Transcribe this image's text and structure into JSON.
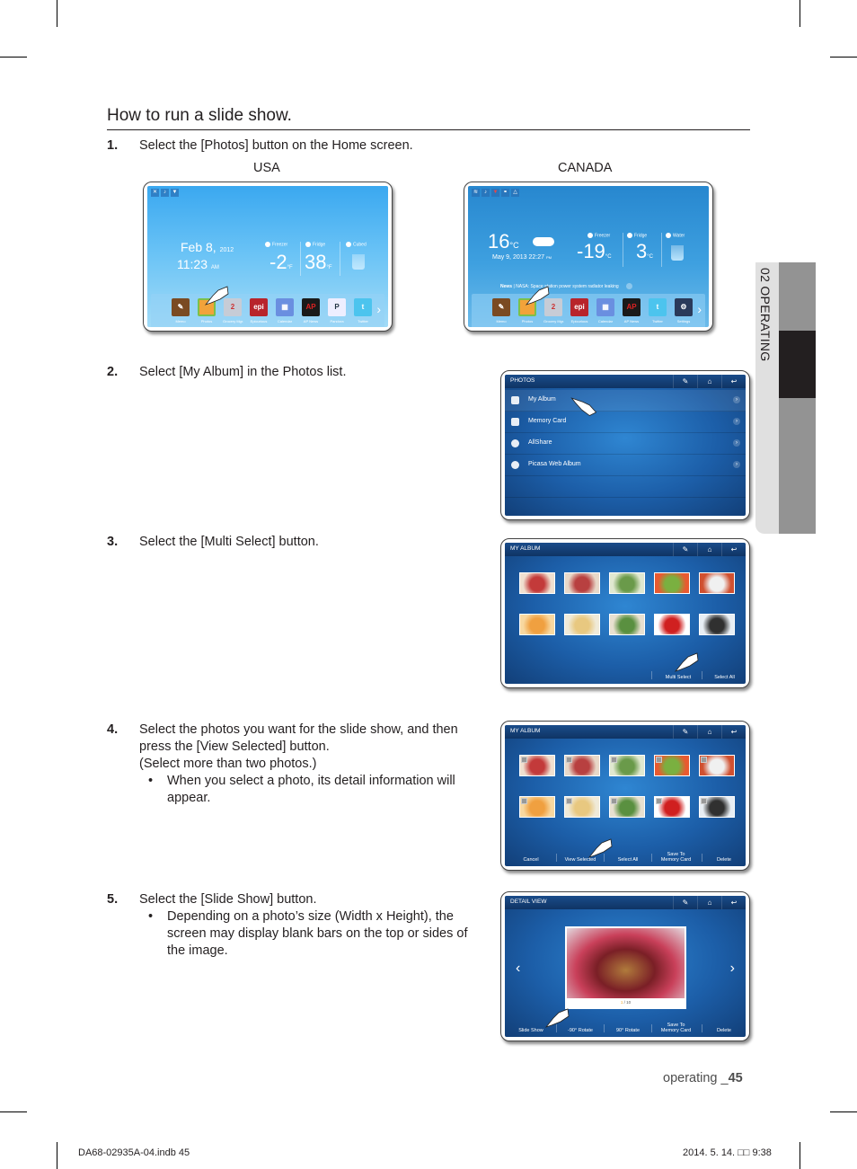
{
  "section": {
    "title": "How to run a slide show."
  },
  "steps": [
    {
      "num": "1.",
      "text": "Select the [Photos] button on the Home screen."
    },
    {
      "num": "2.",
      "text": "Select [My Album] in the Photos list."
    },
    {
      "num": "3.",
      "text": "Select the [Multi Select] button."
    },
    {
      "num": "4.",
      "lines": [
        "Select the photos you want for the slide show, and then",
        "press the [View Selected] button.",
        "(Select more than two photos.)"
      ],
      "bullet": [
        "When you select a photo, its detail information will",
        "appear."
      ]
    },
    {
      "num": "5.",
      "text": "Select the [Slide Show] button.",
      "bullet": [
        "Depending on a photo’s size (Width x Height), the",
        "screen may display blank bars on the top or sides of",
        "the image."
      ]
    }
  ],
  "regions": {
    "usa": "USA",
    "canada": "CANADA"
  },
  "home_usa": {
    "date": "Feb 8,",
    "year": "2012",
    "time": "11:23",
    "ampm": "AM",
    "freezer_label": "Freezer",
    "freezer_temp": "-2",
    "freezer_unit": "°F",
    "fridge_label": "Fridge",
    "fridge_temp": "38",
    "fridge_unit": "°F",
    "ice_label": "Cubed",
    "apps": [
      "Memo",
      "Photos",
      "Grocery Mgr.",
      "Epicurious",
      "Calendar",
      "AP News",
      "Pandora",
      "Twitter"
    ]
  },
  "home_canada": {
    "outside_temp": "16",
    "outside_unit": "°C",
    "datetime": "May 9, 2013 22:27",
    "ampm": "PM",
    "freezer_label": "Freezer",
    "freezer_temp": "-19",
    "freezer_unit": "°C",
    "fridge_label": "Fridge",
    "fridge_temp": "3",
    "fridge_unit": "°C",
    "water_label": "Water",
    "news_label": "News",
    "news_text": "NASA: Space station power system radiator leaking",
    "apps": [
      "Memo",
      "Photos",
      "Grocery Mgr.",
      "Epicurious",
      "Calendar",
      "AP News",
      "Twitter",
      "Settings"
    ]
  },
  "photos_screen": {
    "title": "PHOTOS",
    "items": [
      "My Album",
      "Memory Card",
      "AllShare",
      "Picasa Web Album"
    ]
  },
  "album_screen": {
    "title": "MY ALBUM",
    "buttons": [
      "Multi Select",
      "Select All"
    ]
  },
  "album_multi_screen": {
    "title": "MY ALBUM",
    "buttons": [
      "Cancel",
      "View Selected",
      "Select All",
      "Save To\nMemory Card",
      "Delete"
    ]
  },
  "detail_screen": {
    "title": "DETAIL VIEW",
    "page_current": "1",
    "page_total": " / 10",
    "buttons": [
      "Slide Show",
      "-90° Rotate",
      "90° Rotate",
      "Save To\nMemory Card",
      "Delete"
    ]
  },
  "side_tab": {
    "label": "02  OPERATING"
  },
  "page_footer": {
    "label": "operating _",
    "number": "45"
  },
  "print_info": {
    "left": "DA68-02935A-04.indb   45",
    "right": "2014. 5. 14.   □□ 9:38"
  }
}
